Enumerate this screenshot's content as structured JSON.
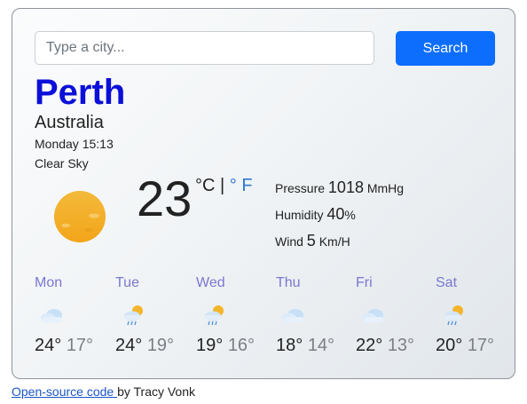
{
  "search": {
    "placeholder": "Type a city...",
    "value": "",
    "button_label": "Search"
  },
  "current": {
    "city": "Perth",
    "country": "Australia",
    "datetime": "Monday 15:13",
    "condition": "Clear Sky",
    "temperature": "23",
    "unit_c": "°C",
    "unit_sep": " | ",
    "unit_f": "° F",
    "icon": "clear-sky-sun-icon",
    "details": [
      {
        "label": "Pressure",
        "value": "1018",
        "unit": "MmHg"
      },
      {
        "label": "Humidity",
        "value": "40",
        "unit": "%"
      },
      {
        "label": "Wind",
        "value": "5",
        "unit": "Km/H"
      }
    ]
  },
  "forecast": [
    {
      "day": "Mon",
      "icon": "cloudy-icon",
      "max": "24°",
      "min": "17°"
    },
    {
      "day": "Tue",
      "icon": "sun-rain-cloud-icon",
      "max": "24°",
      "min": "19°"
    },
    {
      "day": "Wed",
      "icon": "sun-rain-cloud-icon",
      "max": "19°",
      "min": "16°"
    },
    {
      "day": "Thu",
      "icon": "cloudy-icon",
      "max": "18°",
      "min": "14°"
    },
    {
      "day": "Fri",
      "icon": "cloudy-icon",
      "max": "22°",
      "min": "13°"
    },
    {
      "day": "Sat",
      "icon": "sun-rain-cloud-icon",
      "max": "20°",
      "min": "17°"
    }
  ],
  "footer": {
    "link_text": "Open-source code ",
    "suffix": "by Tracy Vonk"
  },
  "colors": {
    "accent": "#0d6efd",
    "city": "#0b10d8",
    "day_name": "#7a77d0",
    "unit_link": "#2f77d0"
  }
}
